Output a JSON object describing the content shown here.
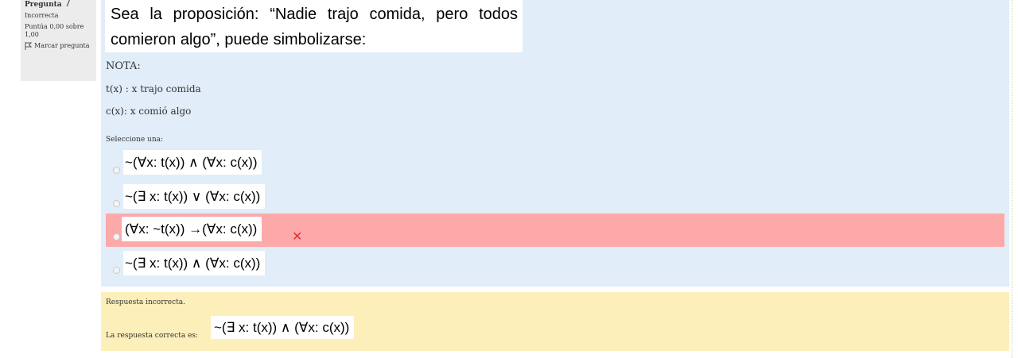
{
  "info": {
    "label": "Pregunta",
    "number": "7",
    "state": "Incorrecta",
    "grade": "Puntúa 0,00 sobre 1,00",
    "flag": "Marcar pregunta"
  },
  "question": {
    "line1": "Sea la proposición:   “Nadie trajo comida, pero todos",
    "line2": "comieron algo”, puede simbolizarse:",
    "nota": "NOTA:",
    "def1": "t(x) : x trajo comida",
    "def2": "c(x): x comió algo",
    "prompt": "Seleccione una:"
  },
  "options": [
    {
      "text": "~(∀x: t(x)) ∧ (∀x: c(x))",
      "selected": false,
      "incorrect": false
    },
    {
      "text": "~(∃ x: t(x)) ∨ (∀x: c(x))",
      "selected": false,
      "incorrect": false
    },
    {
      "text": "(∀x: ~t(x)) →(∀x: c(x))",
      "selected": true,
      "incorrect": true
    },
    {
      "text": "~(∃ x: t(x)) ∧ (∀x: c(x))",
      "selected": false,
      "incorrect": false
    }
  ],
  "feedback": {
    "status": "Respuesta incorrecta.",
    "correct_label": "La respuesta correcta es:",
    "correct_answer": "~(∃ x: t(x)) ∧ (∀x: c(x))"
  },
  "colors": {
    "formulation_bg": "#e1edf8",
    "incorrect_bg": "#fda9aa",
    "feedback_bg": "#fcefba",
    "accent_green": "#1e7a5b",
    "wrong_mark": "#e0302f"
  },
  "icons": {
    "flag": "flag-icon",
    "wrong": "cross-icon"
  }
}
